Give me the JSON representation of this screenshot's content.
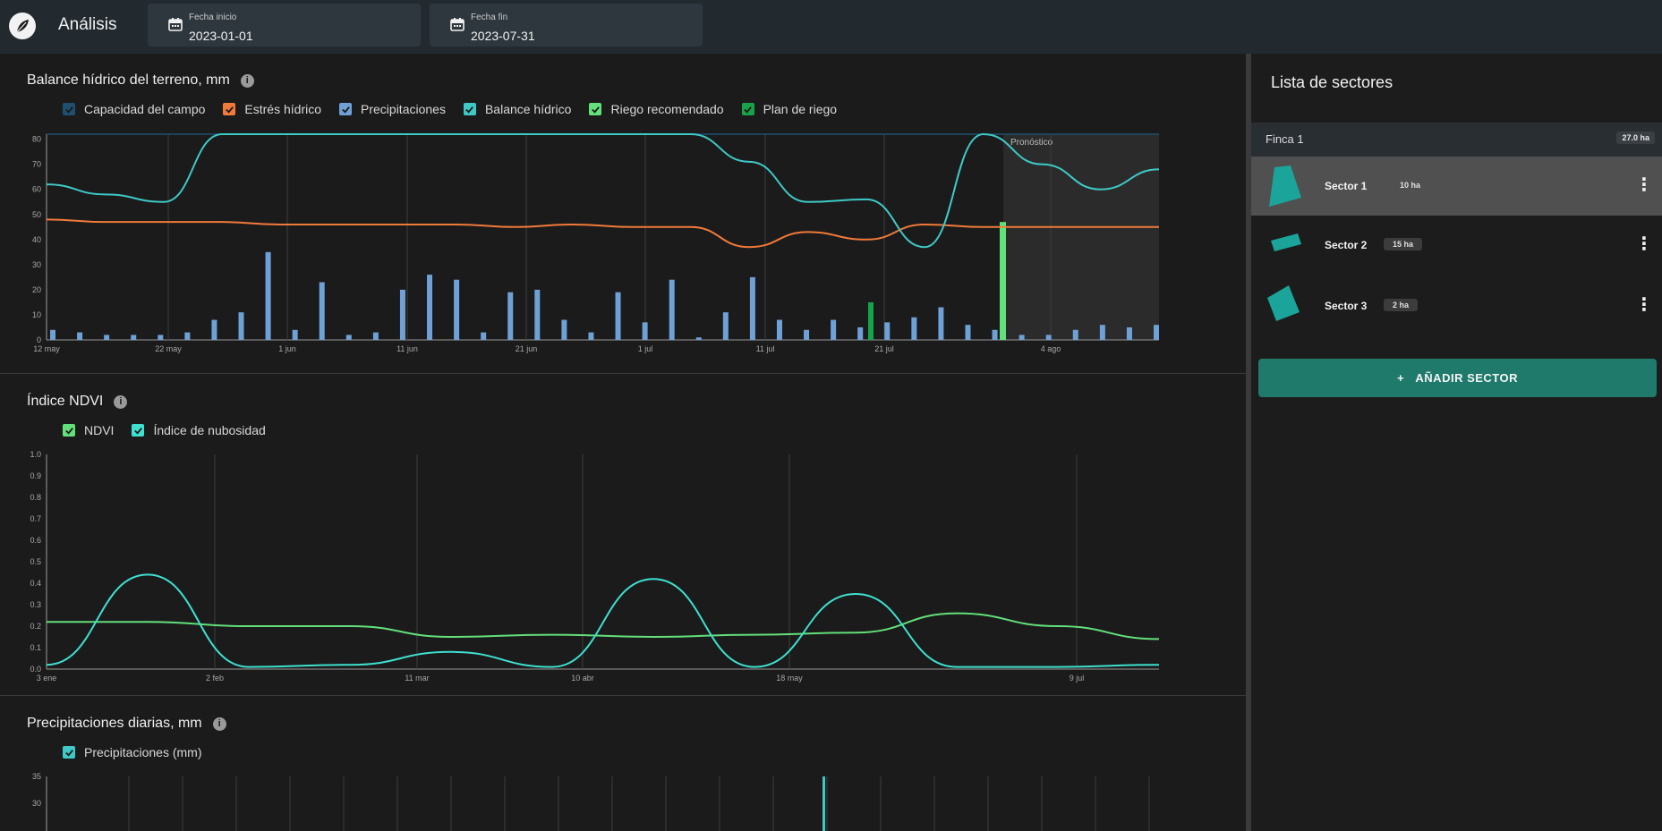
{
  "header": {
    "title": "Análisis",
    "start_date": {
      "label": "Fecha inicio",
      "value": "2023-01-01"
    },
    "end_date": {
      "label": "Fecha fin",
      "value": "2023-07-31"
    }
  },
  "water_balance": {
    "title": "Balance hídrico del terreno, mm",
    "legend": [
      {
        "label": "Capacidad del campo",
        "color": "#1f4f6e"
      },
      {
        "label": "Estrés hídrico",
        "color": "#f07a3a"
      },
      {
        "label": "Precipitaciones",
        "color": "#6fa0d6"
      },
      {
        "label": "Balance hídrico",
        "color": "#3ec9c6"
      },
      {
        "label": "Riego recomendado",
        "color": "#62e07a"
      },
      {
        "label": "Plan de riego",
        "color": "#17a34a"
      }
    ],
    "forecast_label": "Pronóstico",
    "y_ticks": [
      "80",
      "70",
      "60",
      "50",
      "40",
      "30",
      "20",
      "10",
      "0"
    ],
    "x_ticks": [
      "12 may",
      "22 may",
      "1 jun",
      "11 jun",
      "21 jun",
      "1 jul",
      "11 jul",
      "21 jul",
      "4 ago"
    ]
  },
  "ndvi": {
    "title": "Índice NDVI",
    "legend": [
      {
        "label": "NDVI",
        "color": "#62e07a"
      },
      {
        "label": "Índice de nubosidad",
        "color": "#3ee0d0"
      }
    ],
    "y_ticks": [
      "1.0",
      "0.9",
      "0.8",
      "0.7",
      "0.6",
      "0.5",
      "0.4",
      "0.3",
      "0.2",
      "0.1",
      "0.0"
    ],
    "x_ticks": [
      "3 ene",
      "2 feb",
      "11 mar",
      "10 abr",
      "18 may",
      "9 jul"
    ]
  },
  "precipitation": {
    "title": "Precipitaciones diarias, mm",
    "legend": [
      {
        "label": "Precipitaciones (mm)",
        "color": "#3ec9c6"
      }
    ],
    "y_ticks": [
      "35",
      "30"
    ]
  },
  "sidebar": {
    "title": "Lista de sectores",
    "farm": {
      "name": "Finca 1",
      "area": "27.0 ha"
    },
    "sectors": [
      {
        "name": "Sector 1",
        "area": "10 ha"
      },
      {
        "name": "Sector 2",
        "area": "15 ha"
      },
      {
        "name": "Sector 3",
        "area": "2 ha"
      }
    ],
    "add_button": "AÑADIR SECTOR"
  },
  "chart_data": [
    {
      "type": "line",
      "title": "Balance hídrico del terreno, mm",
      "ylim": [
        0,
        82
      ],
      "x": [
        "12 may",
        "17 may",
        "22 may",
        "27 may",
        "1 jun",
        "6 jun",
        "11 jun",
        "16 jun",
        "21 jun",
        "26 jun",
        "1 jul",
        "6 jul",
        "11 jul",
        "16 jul",
        "21 jul",
        "26 jul",
        "31 jul",
        "4 ago",
        "9 ago",
        "13 ago"
      ],
      "series": [
        {
          "name": "Capacidad del campo",
          "values": [
            82,
            82,
            82,
            82,
            82,
            82,
            82,
            82,
            82,
            82,
            82,
            82,
            82,
            82,
            82,
            82,
            82,
            82,
            82,
            82
          ]
        },
        {
          "name": "Estrés hídrico",
          "values": [
            48,
            47,
            47,
            47,
            46,
            46,
            46,
            46,
            45,
            46,
            45,
            45,
            37,
            43,
            40,
            46,
            45,
            45,
            45,
            45
          ]
        },
        {
          "name": "Balance hídrico",
          "values": [
            62,
            58,
            55,
            82,
            82,
            82,
            82,
            82,
            82,
            82,
            82,
            82,
            71,
            55,
            56,
            37,
            83,
            70,
            60,
            68
          ]
        }
      ]
    },
    {
      "type": "line",
      "title": "Índice NDVI",
      "ylim": [
        0,
        1
      ],
      "x": [
        "3 ene",
        "17 ene",
        "2 feb",
        "20 feb",
        "11 mar",
        "25 mar",
        "10 abr",
        "28 abr",
        "18 may",
        "10 jun",
        "9 jul",
        "31 jul"
      ],
      "series": [
        {
          "name": "NDVI",
          "values": [
            0.22,
            0.22,
            0.2,
            0.2,
            0.15,
            0.16,
            0.15,
            0.16,
            0.17,
            0.26,
            0.2,
            0.14
          ]
        },
        {
          "name": "Índice de nubosidad",
          "values": [
            0.02,
            0.44,
            0.01,
            0.02,
            0.08,
            0.01,
            0.42,
            0.01,
            0.35,
            0.01,
            0.01,
            0.02
          ]
        }
      ]
    },
    {
      "type": "bar",
      "title": "Balance hídrico del terreno, mm",
      "series": [
        {
          "name": "Precipitaciones",
          "values": [
            4,
            3,
            2,
            2,
            2,
            3,
            8,
            11,
            35,
            4,
            23,
            2,
            3,
            20,
            26,
            24,
            3,
            19,
            20,
            8,
            3,
            19,
            7,
            24,
            1,
            11,
            25,
            8,
            4,
            8,
            5,
            7,
            9,
            13,
            6,
            4,
            2,
            2,
            4,
            6,
            5,
            6
          ]
        },
        {
          "name": "Plan de riego",
          "values": [
            15
          ]
        },
        {
          "name": "Riego recomendado",
          "values": [
            47
          ]
        }
      ]
    }
  ]
}
